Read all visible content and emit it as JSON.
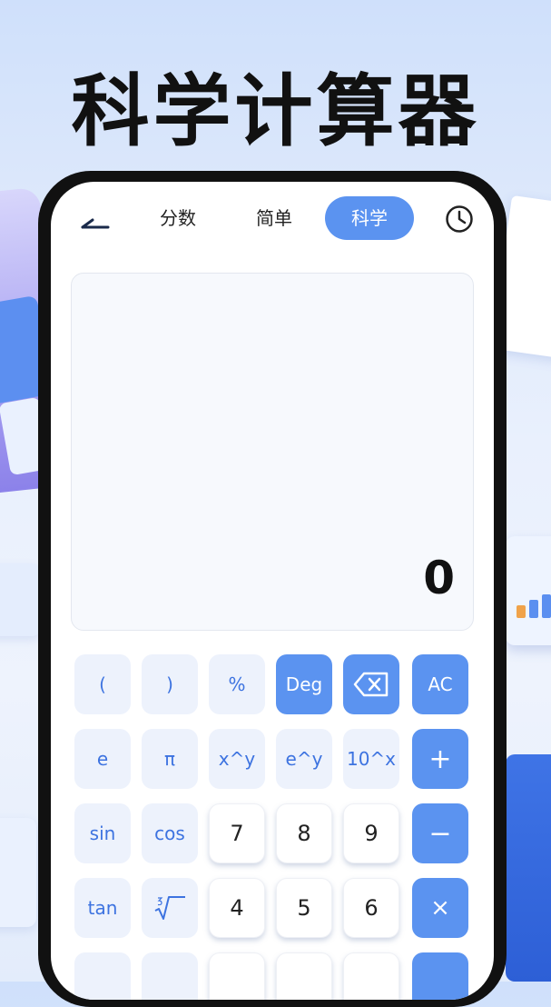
{
  "headline": "科学计算器",
  "tabs": [
    {
      "label": "分数"
    },
    {
      "label": "简单"
    },
    {
      "label": "科学",
      "active": true
    }
  ],
  "icons": {
    "back": "back-arrow-icon",
    "history": "clock-icon",
    "delete": "backspace-icon"
  },
  "display": {
    "value": "0"
  },
  "keys": {
    "lparen": "(",
    "rparen": ")",
    "percent": "%",
    "deg": "Deg",
    "ac": "AC",
    "e": "e",
    "pi": "π",
    "xpowy": "x^y",
    "epowy": "e^y",
    "tenpowx": "10^x",
    "plus": "+",
    "sin": "sin",
    "cos": "cos",
    "seven": "7",
    "eight": "8",
    "nine": "9",
    "minus": "−",
    "tan": "tan",
    "four": "4",
    "five": "5",
    "six": "6",
    "times": "×"
  },
  "colors": {
    "accent": "#5b93f0",
    "function_bg": "#edf2fc",
    "function_text": "#3d73e0",
    "frame": "#111111"
  }
}
